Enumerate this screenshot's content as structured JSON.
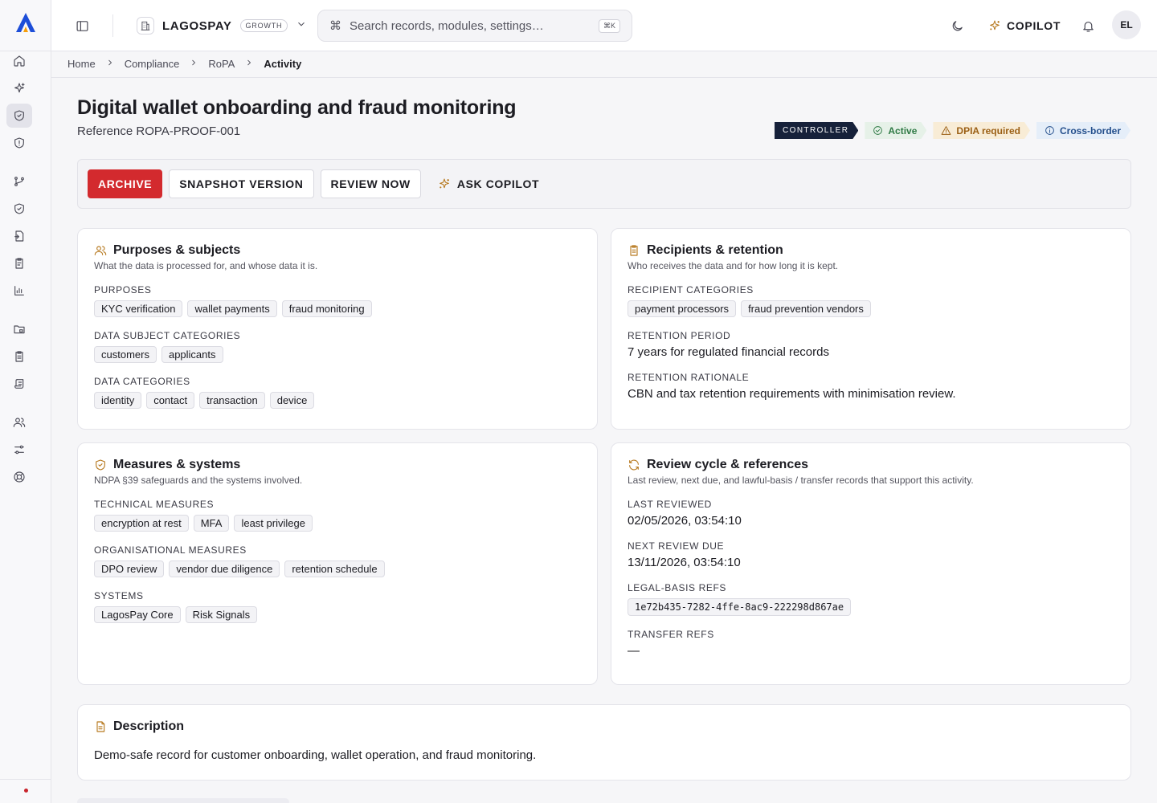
{
  "topbar": {
    "org_name": "LAGOSPAY",
    "org_plan": "GROWTH",
    "search_placeholder": "Search records, modules, settings…",
    "search_shortcut": "⌘K",
    "copilot_label": "COPILOT",
    "avatar_initials": "EL"
  },
  "sidebar": {
    "items": [
      {
        "icon": "home-icon"
      },
      {
        "icon": "sparkle-icon"
      },
      {
        "icon": "shield-check-icon",
        "active": true
      },
      {
        "icon": "shield-alert-icon"
      },
      {
        "icon": "git-branch-icon"
      },
      {
        "icon": "shield-icon"
      },
      {
        "icon": "file-check-icon"
      },
      {
        "icon": "clipboard-icon"
      },
      {
        "icon": "bar-chart-icon"
      },
      {
        "icon": "folder-lock-icon"
      },
      {
        "icon": "clipboard-list-icon"
      },
      {
        "icon": "scroll-icon"
      },
      {
        "icon": "users-icon"
      },
      {
        "icon": "sliders-icon"
      },
      {
        "icon": "lifebuoy-icon"
      }
    ]
  },
  "breadcrumb": [
    "Home",
    "Compliance",
    "RoPA",
    "Activity"
  ],
  "header": {
    "title": "Digital wallet onboarding and fraud monitoring",
    "reference": "Reference ROPA-PROOF-001",
    "badges": {
      "role": "CONTROLLER",
      "status": "Active",
      "dpia": "DPIA required",
      "transfer": "Cross-border"
    },
    "status_colors": {
      "active": "#2f7a45",
      "dpia": "#9b5f14",
      "cross": "#244f8c",
      "primary": "#d32a2e"
    }
  },
  "actions": {
    "archive": "ARCHIVE",
    "snapshot": "SNAPSHOT VERSION",
    "review": "REVIEW NOW",
    "copilot": "ASK COPILOT"
  },
  "purposes_card": {
    "title": "Purposes & subjects",
    "subtitle": "What the data is processed for, and whose data it is.",
    "purposes_label": "PURPOSES",
    "purposes": [
      "KYC verification",
      "wallet payments",
      "fraud monitoring"
    ],
    "subjects_label": "DATA SUBJECT CATEGORIES",
    "subjects": [
      "customers",
      "applicants"
    ],
    "data_label": "DATA CATEGORIES",
    "data": [
      "identity",
      "contact",
      "transaction",
      "device"
    ]
  },
  "recipients_card": {
    "title": "Recipients & retention",
    "subtitle": "Who receives the data and for how long it is kept.",
    "recipients_label": "RECIPIENT CATEGORIES",
    "recipients": [
      "payment processors",
      "fraud prevention vendors"
    ],
    "period_label": "RETENTION PERIOD",
    "period": "7 years for regulated financial records",
    "rationale_label": "RETENTION RATIONALE",
    "rationale": "CBN and tax retention requirements with minimisation review."
  },
  "measures_card": {
    "title": "Measures & systems",
    "subtitle": "NDPA §39 safeguards and the systems involved.",
    "technical_label": "TECHNICAL MEASURES",
    "technical": [
      "encryption at rest",
      "MFA",
      "least privilege"
    ],
    "org_label": "ORGANISATIONAL MEASURES",
    "org": [
      "DPO review",
      "vendor due diligence",
      "retention schedule"
    ],
    "systems_label": "SYSTEMS",
    "systems": [
      "LagosPay Core",
      "Risk Signals"
    ]
  },
  "review_card": {
    "title": "Review cycle & references",
    "subtitle": "Last review, next due, and lawful-basis / transfer records that support this activity.",
    "last_label": "LAST REVIEWED",
    "last": "02/05/2026, 03:54:10",
    "next_label": "NEXT REVIEW DUE",
    "next": "13/11/2026, 03:54:10",
    "legal_label": "LEGAL-BASIS REFS",
    "legal_ref": "1e72b435-7282-4ffe-8ac9-222298d867ae",
    "transfer_label": "TRANSFER REFS",
    "transfer": "—"
  },
  "description_card": {
    "title": "Description",
    "text": "Demo-safe record for customer onboarding, wallet operation, and fraud monitoring."
  }
}
